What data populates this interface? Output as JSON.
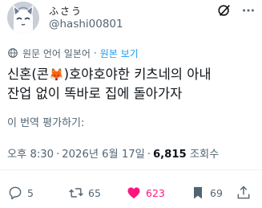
{
  "author": {
    "display_name": "ふさう",
    "handle": "@hashi00801",
    "avatar_icon": "cat-avatar-icon"
  },
  "header_icons": [
    "grok-icon",
    "more-icon"
  ],
  "translation": {
    "icon": "globe-icon",
    "label": "원문 언어 일본어",
    "link_label": "원본 보기"
  },
  "tweet": {
    "line1_before": "신혼(콘",
    "emoji": "🦊",
    "line1_after": ")호야호야한 키츠네의 아내",
    "line2": "잔업 없이 똑바로 집에 돌아가자"
  },
  "translate_post": "이 번역 평가하기:",
  "meta": {
    "time": "오후 8:30",
    "date": "2026년 6월 17일",
    "views_count": "6,815",
    "views_label": "조회수"
  },
  "actions": {
    "replies": "5",
    "retweets": "65",
    "likes": "623",
    "bookmarks": "69"
  },
  "colors": {
    "accent": "#1d9bf0",
    "like": "#f91880",
    "muted": "#536471",
    "text": "#0f1419"
  }
}
